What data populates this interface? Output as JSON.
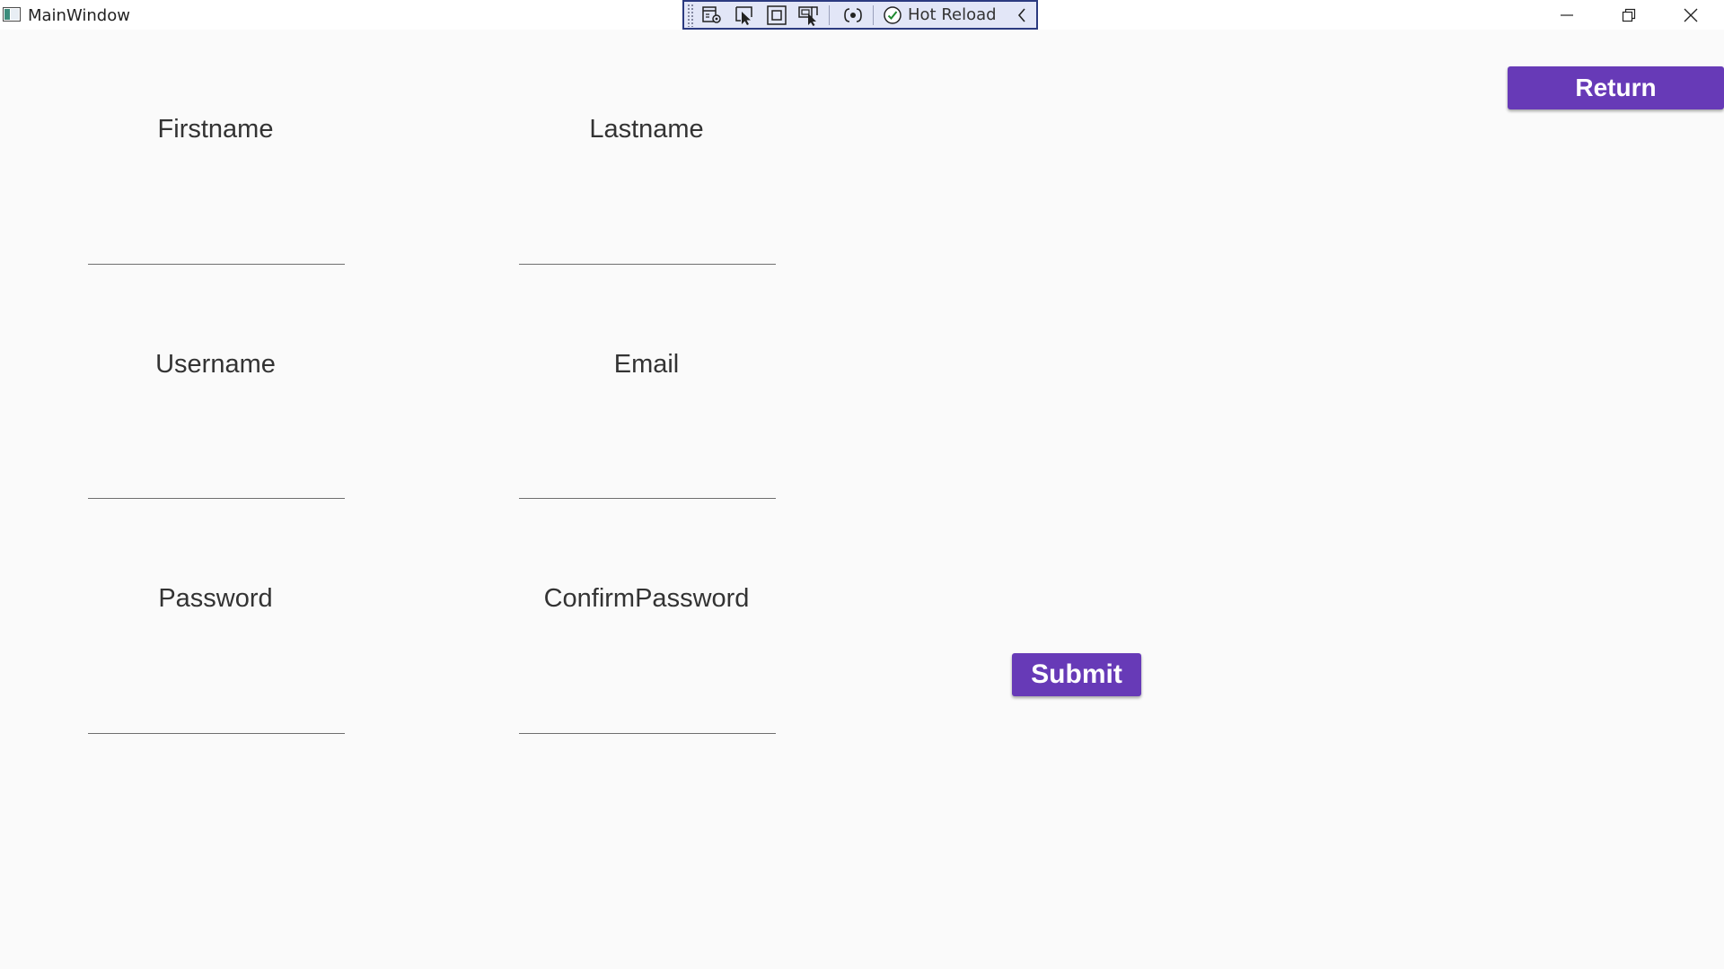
{
  "window": {
    "title": "MainWindow"
  },
  "devbar": {
    "hot_reload_label": "Hot Reload"
  },
  "form": {
    "firstname_label": "Firstname",
    "lastname_label": "Lastname",
    "username_label": "Username",
    "email_label": "Email",
    "password_label": "Password",
    "confirm_password_label": "ConfirmPassword",
    "firstname_value": "",
    "lastname_value": "",
    "username_value": "",
    "email_value": "",
    "password_value": "",
    "confirm_password_value": ""
  },
  "buttons": {
    "return_label": "Return",
    "submit_label": "Submit"
  },
  "colors": {
    "accent": "#673ab7",
    "background": "#fafafa",
    "devbar_border": "#2b3a80"
  },
  "icons": {
    "app": "window-icon",
    "minimize": "minimize-icon",
    "restore": "restore-icon",
    "close": "close-icon",
    "live_visual_tree": "live-visual-tree-icon",
    "select_element": "select-element-icon",
    "display_layout_adorners": "layout-adorners-icon",
    "track_focus": "track-focus-icon",
    "binding_failures": "binding-failures-icon",
    "hot_reload_status": "check-circle-icon",
    "collapse": "chevron-left-icon"
  }
}
